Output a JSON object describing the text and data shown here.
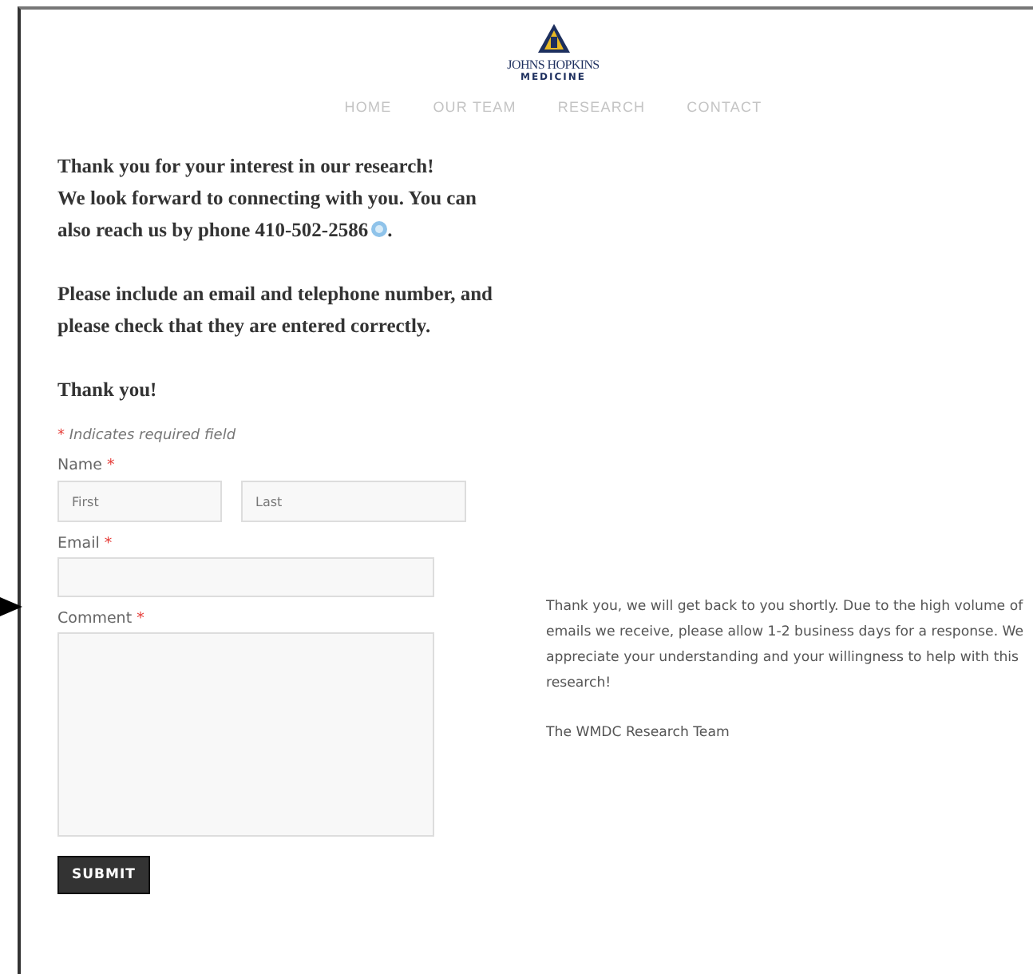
{
  "logo": {
    "name": "JOHNS HOPKINS",
    "subtitle": "MEDICINE"
  },
  "nav": [
    {
      "label": "HOME"
    },
    {
      "label": "OUR TEAM"
    },
    {
      "label": "RESEARCH"
    },
    {
      "label": "CONTACT"
    }
  ],
  "intro": {
    "lines": [
      "Thank you for your interest in our research!",
      "We look forward to connecting with you. You can"
    ],
    "phone_line": "also reach us by phone 410-502-2586",
    "phone_end": ".",
    "instructions": "Please include an email and telephone number, and please check that they are entered correctly.",
    "thanks": "Thank you!"
  },
  "form": {
    "required_mark": "*",
    "required_note": "Indicates required field",
    "name_label": "Name",
    "first_placeholder": "First",
    "last_placeholder": "Last",
    "email_label": "Email",
    "comment_label": "Comment",
    "submit": "SUBMIT"
  },
  "sidebar": {
    "message": "Thank you, we will get back to you shortly. Due to the high volume of emails we receive, please allow 1-2 business days for a response. We appreciate your understanding and your willingness to help with this research!",
    "signature": "The WMDC Research Team"
  }
}
